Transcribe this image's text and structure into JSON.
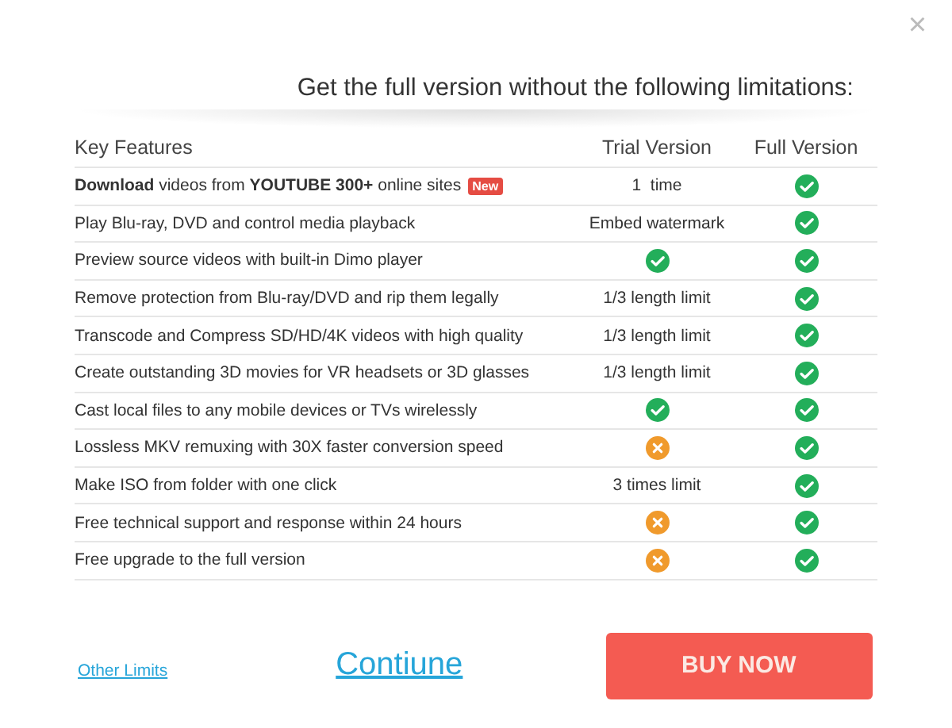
{
  "close": "×",
  "title": "Get the full version without the following limitations:",
  "table": {
    "columns": [
      "Key Features",
      "Trial Version",
      "Full Version"
    ],
    "rows": [
      {
        "feature": "**Download** videos from **YOUTUBE 300+** online sites",
        "badge": "New",
        "trial": {
          "kind": "text",
          "text": "1  time"
        },
        "full": {
          "kind": "check"
        }
      },
      {
        "feature": "Play Blu-ray, DVD and control media playback",
        "trial": {
          "kind": "text",
          "text": "Embed watermark"
        },
        "full": {
          "kind": "check"
        }
      },
      {
        "feature": "Preview source videos with built-in Dimo player",
        "trial": {
          "kind": "check"
        },
        "full": {
          "kind": "check"
        }
      },
      {
        "feature": "Remove protection from Blu-ray/DVD and rip them legally",
        "trial": {
          "kind": "text",
          "text": "1/3 length limit"
        },
        "full": {
          "kind": "check"
        }
      },
      {
        "feature": "Transcode and Compress SD/HD/4K videos with high quality",
        "trial": {
          "kind": "text",
          "text": "1/3 length limit"
        },
        "full": {
          "kind": "check"
        }
      },
      {
        "feature": "Create outstanding 3D movies for VR headsets or 3D glasses",
        "trial": {
          "kind": "text",
          "text": "1/3 length limit"
        },
        "full": {
          "kind": "check"
        }
      },
      {
        "feature": "Cast local files to any mobile devices or TVs wirelessly",
        "trial": {
          "kind": "check"
        },
        "full": {
          "kind": "check"
        }
      },
      {
        "feature": "Lossless MKV remuxing with 30X faster conversion speed",
        "trial": {
          "kind": "cross"
        },
        "full": {
          "kind": "check"
        }
      },
      {
        "feature": "Make ISO from folder with one click",
        "trial": {
          "kind": "text",
          "text": "3 times limit"
        },
        "full": {
          "kind": "check"
        }
      },
      {
        "feature": "Free technical support and response within 24 hours",
        "trial": {
          "kind": "cross"
        },
        "full": {
          "kind": "check"
        }
      },
      {
        "feature": "Free upgrade to the full version",
        "trial": {
          "kind": "cross"
        },
        "full": {
          "kind": "check"
        }
      }
    ]
  },
  "links": {
    "other_limits": "Other Limits",
    "continue": "Contiune"
  },
  "buy_button": "BUY NOW"
}
